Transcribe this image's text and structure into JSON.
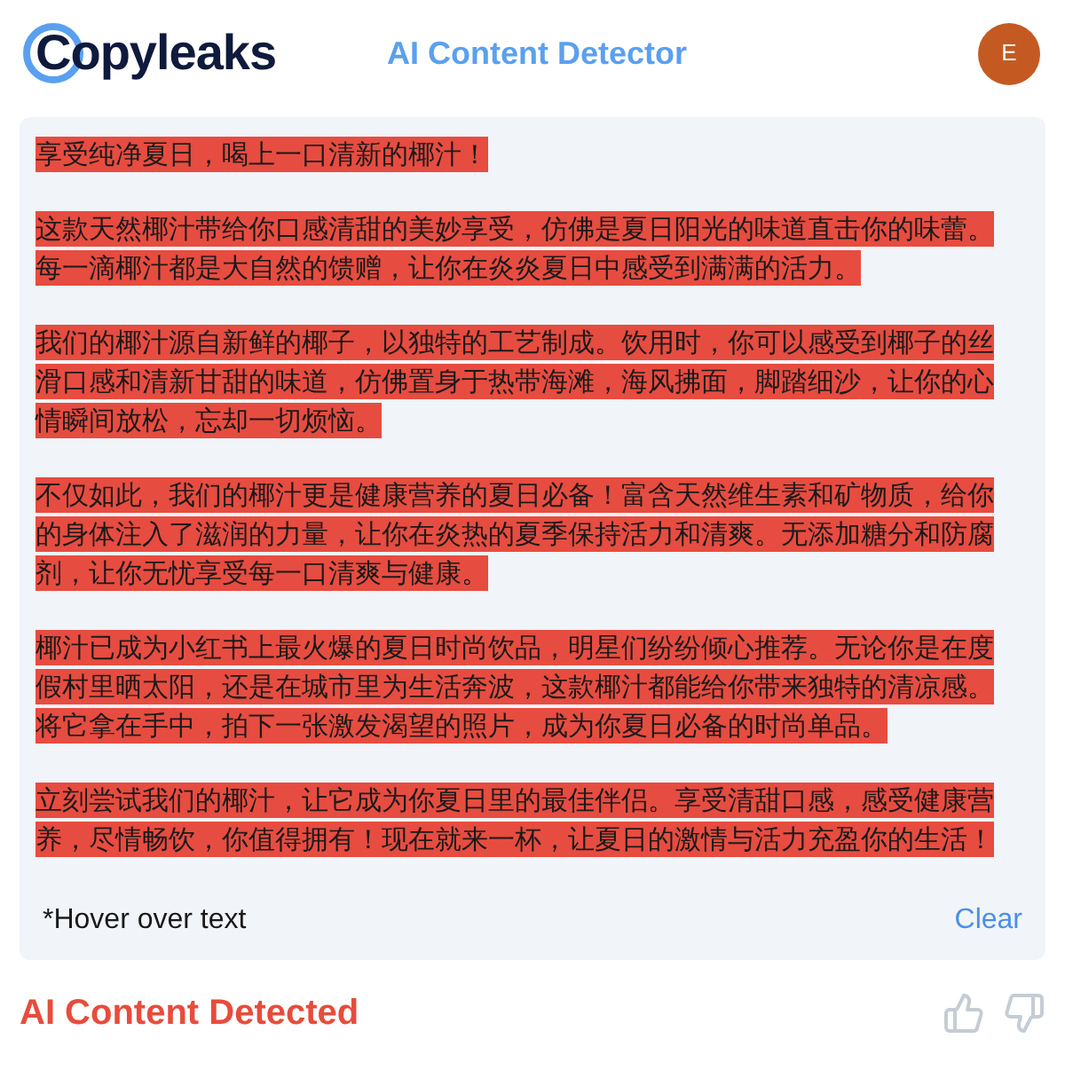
{
  "header": {
    "logo": "Copyleaks",
    "title": "AI Content Detector",
    "avatar": "E"
  },
  "paragraphs": [
    {
      "ai_detected": true,
      "lines": [
        "享受纯净夏日，喝上一口清新的椰汁！"
      ]
    },
    {
      "ai_detected": true,
      "lines": [
        "这款天然椰汁带给你口感清甜的美妙享受，仿佛是夏日阳光的味道直击你的味蕾。",
        "每一滴椰汁都是大自然的馈赠，让你在炎炎夏日中感受到满满的活力。"
      ]
    },
    {
      "ai_detected": true,
      "lines": [
        "我们的椰汁源自新鲜的椰子，以独特的工艺制成。饮用时，你可以感受到椰子的丝",
        "滑口感和清新甘甜的味道，仿佛置身于热带海滩，海风拂面，脚踏细沙，让你的心",
        "情瞬间放松，忘却一切烦恼。"
      ]
    },
    {
      "ai_detected": true,
      "lines": [
        "不仅如此，我们的椰汁更是健康营养的夏日必备！富含天然维生素和矿物质，给你",
        "的身体注入了滋润的力量，让你在炎热的夏季保持活力和清爽。无添加糖分和防腐",
        "剂，让你无忧享受每一口清爽与健康。"
      ]
    },
    {
      "ai_detected": true,
      "lines": [
        "椰汁已成为小红书上最火爆的夏日时尚饮品，明星们纷纷倾心推荐。无论你是在度",
        "假村里晒太阳，还是在城市里为生活奔波，这款椰汁都能给你带来独特的清凉感。",
        "将它拿在手中，拍下一张激发渴望的照片，成为你夏日必备的时尚单品。"
      ]
    },
    {
      "ai_detected": true,
      "lines": [
        "立刻尝试我们的椰汁，让它成为你夏日里的最佳伴侣。享受清甜口感，感受健康营",
        "养，尽情畅饮，你值得拥有！现在就来一杯，让夏日的激情与活力充盈你的生活！"
      ]
    }
  ],
  "hint": "*Hover over text",
  "clear_button": "Clear",
  "result": "AI Content Detected"
}
